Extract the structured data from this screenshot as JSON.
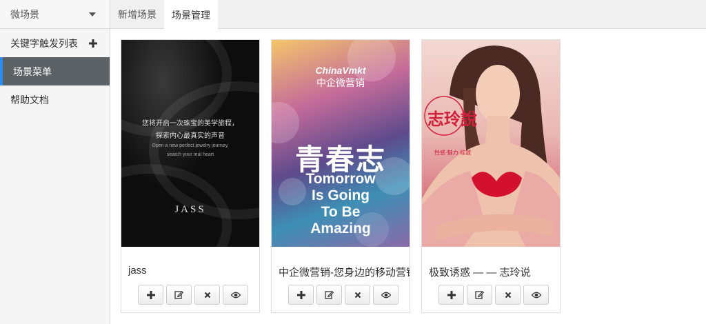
{
  "sidebar": {
    "header_label": "微场景",
    "items": [
      {
        "label": "关键字触发列表",
        "has_plus": true
      },
      {
        "label": "场景菜单",
        "active": true
      },
      {
        "label": "帮助文档"
      }
    ]
  },
  "tabs": [
    {
      "label": "新增场景",
      "active": false
    },
    {
      "label": "场景管理",
      "active": true
    }
  ],
  "cards": [
    {
      "title": "jass",
      "thumb": {
        "line1": "您将开启一次珠宝的美学旅程，",
        "line2": "探索内心最真实的声音",
        "line3": "Open a new perfect jewelry journey,",
        "line4": "search your real heart",
        "brand": "JASS"
      }
    },
    {
      "title": "中企微营销-您身边的移动营销",
      "thumb": {
        "logo": "ChinaVmkt",
        "logo_cn": "中企微营销",
        "headline": "青春志",
        "line1": "Tomorrow",
        "line2": "Is Going",
        "line3": "To Be",
        "line4": "Amazing"
      }
    },
    {
      "title": "极致诱惑 — — 志玲说",
      "thumb": {
        "stamp": "志玲說",
        "tagline": "性感·魅力·绽放"
      }
    }
  ],
  "actions": {
    "add": "plus-icon",
    "edit": "edit-icon",
    "delete": "close-icon",
    "view": "eye-icon"
  },
  "colors": {
    "sidebar_active_bg": "#5c6166",
    "sidebar_active_accent": "#2d8cf0"
  }
}
